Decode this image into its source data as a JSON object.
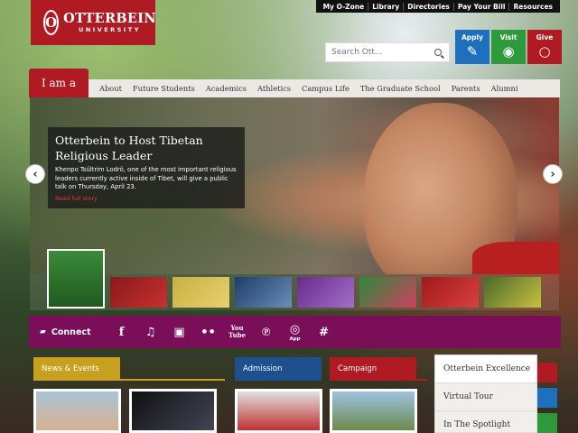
{
  "utility_nav": [
    "My O-Zone",
    "Library",
    "Directories",
    "Pay Your Bill",
    "Resources"
  ],
  "logo": {
    "mark": "O",
    "name": "OTTERBEIN",
    "sub": "UNIVERSITY"
  },
  "search": {
    "placeholder": "Search Ott..."
  },
  "cta": [
    {
      "label": "Apply",
      "icon": "pencil-note-icon",
      "color": "#1e6fbd"
    },
    {
      "label": "Visit",
      "icon": "eye-icon",
      "color": "#2e9a3b"
    },
    {
      "label": "Give",
      "icon": "ring-icon",
      "color": "#b01a22"
    }
  ],
  "nav": {
    "iam": "I am a",
    "items": [
      "About",
      "Future Students",
      "Academics",
      "Athletics",
      "Campus Life",
      "The Graduate School",
      "Parents",
      "Alumni"
    ]
  },
  "hero": {
    "title": "Otterbein to Host Tibetan Religious Leader",
    "body": "Khenpo Tsültrim Lodrö, one of the most important religious leaders currently active inside of Tibet, will give a public talk on Thursday, April 23.",
    "link": "Read full story"
  },
  "connect": {
    "label": "Connect",
    "icons": [
      "facebook-icon",
      "twitter-icon",
      "instagram-icon",
      "flickr-icon",
      "youtube-icon",
      "pinterest-icon",
      "app-icon",
      "hashtag-icon"
    ],
    "youtube_label": "You Tube",
    "app_label": "App"
  },
  "panels": {
    "news": "News & Events",
    "admission": "Admission",
    "campaign": "Campaign"
  },
  "side": [
    "Otterbein Excellence",
    "Virtual Tour",
    "In The Spotlight"
  ],
  "colors": {
    "brand": "#b01a22",
    "connect": "#7a0e58",
    "news": "#c8a020",
    "admission": "#1e4f8f"
  }
}
